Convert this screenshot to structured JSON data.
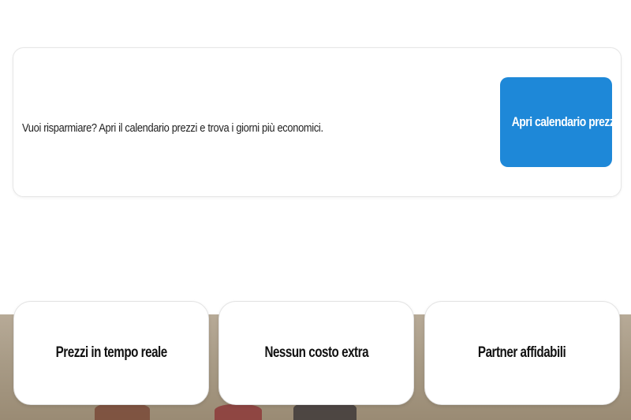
{
  "price_calendar": {
    "text": "Vuoi risparmiare? Apri il calendario prezzi e trova i giorni più economici.",
    "button_label": "Apri calendario prezzi",
    "button_color": "#1e88d8"
  },
  "features": [
    {
      "label": "Prezzi in tempo reale"
    },
    {
      "label": "Nessun costo extra"
    },
    {
      "label": "Partner affidabili"
    }
  ]
}
